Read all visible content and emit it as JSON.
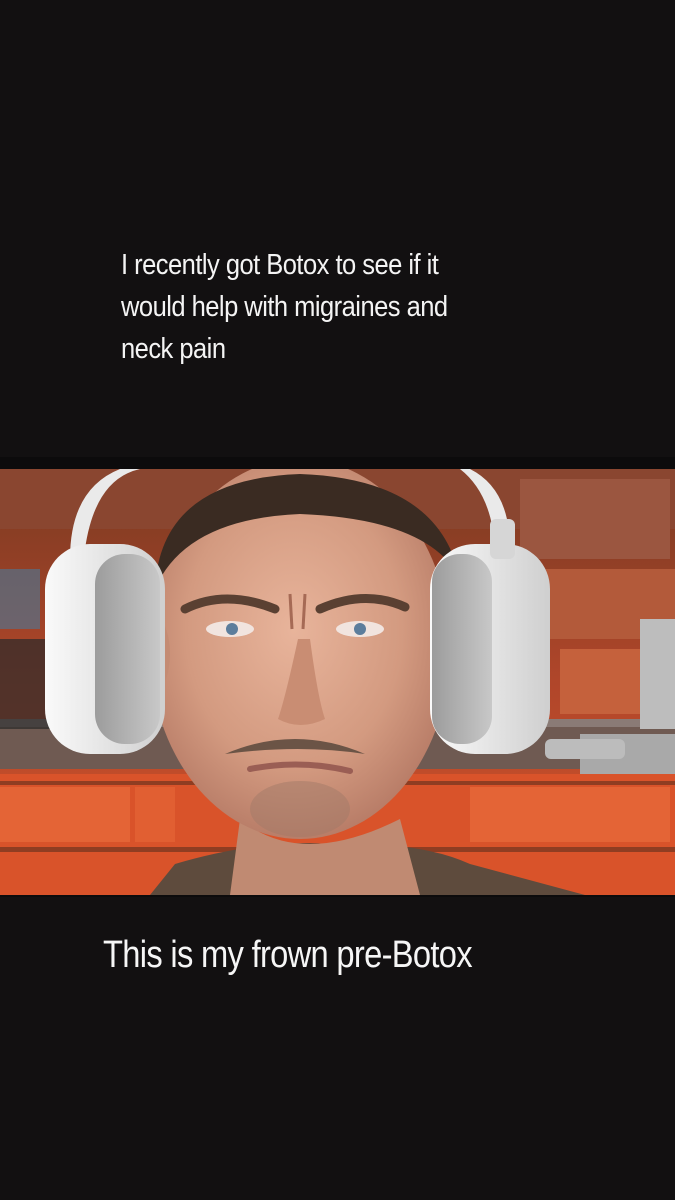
{
  "post": {
    "caption_top_lines": [
      "I recently got Botox to see if it",
      "would help with migraines and",
      "neck pain"
    ],
    "caption_bottom": "This is my frown pre-Botox"
  },
  "photo": {
    "subject": "man frowning wearing white headset",
    "background_colors": {
      "brick": "#c9502a",
      "mortar": "#6e4a3a",
      "skin": "#d59a80",
      "shirt": "#5e4b3d",
      "headset": "#e9e9e9"
    }
  }
}
